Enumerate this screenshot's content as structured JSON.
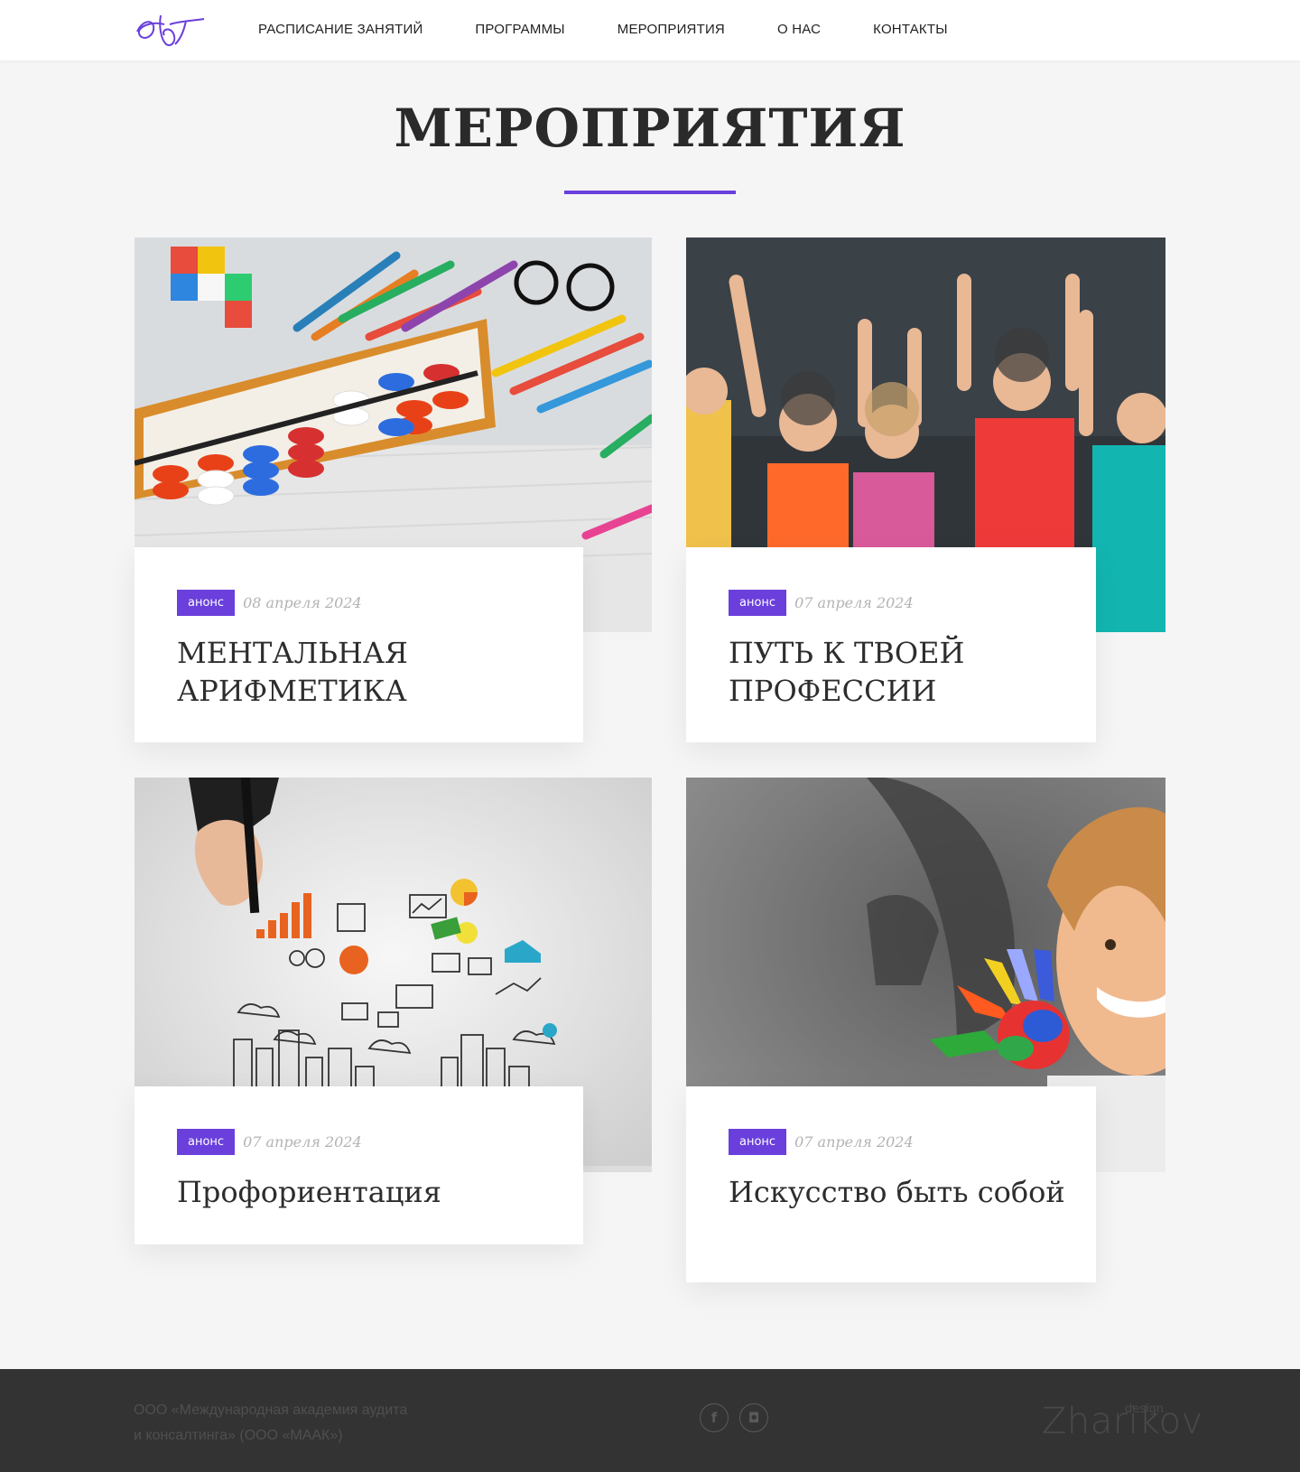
{
  "header": {
    "logo_icon": "script-monogram-logo",
    "nav": [
      {
        "label": "РАСПИСАНИЕ ЗАНЯТИЙ"
      },
      {
        "label": "ПРОГРАММЫ"
      },
      {
        "label": "МЕРОПРИЯТИЯ"
      },
      {
        "label": "О НАС"
      },
      {
        "label": "КОНТАКТЫ"
      }
    ]
  },
  "page": {
    "title": "МЕРОПРИЯТИЯ",
    "accent_color": "#6a3fdc"
  },
  "events": [
    {
      "badge": "анонс",
      "date": "08 апреля 2024",
      "title": "МЕНТАЛЬНАЯ АРИФМЕТИКА",
      "image": "abacus-and-pencils-photo"
    },
    {
      "badge": "анонс",
      "date": "07 апреля 2024",
      "title": "ПУТЬ К ТВОЕЙ ПРОФЕССИИ",
      "image": "cheering-children-photo"
    },
    {
      "badge": "анонс",
      "date": "07 апреля 2024",
      "title": "Профориентация",
      "image": "business-sketch-photo"
    },
    {
      "badge": "анонс",
      "date": "07 апреля 2024",
      "title": "Искусство быть собой",
      "image": "girl-with-painted-hand-photo"
    }
  ],
  "footer": {
    "company_line1": "ООО «Международная академия аудита",
    "company_line2": "и консалтинга» (ООО «МААК»)",
    "social": [
      {
        "icon": "facebook-icon",
        "glyph": "f"
      },
      {
        "icon": "instagram-icon",
        "glyph": "◘"
      }
    ],
    "brand": "Zharikov",
    "brand_sub": "design"
  }
}
